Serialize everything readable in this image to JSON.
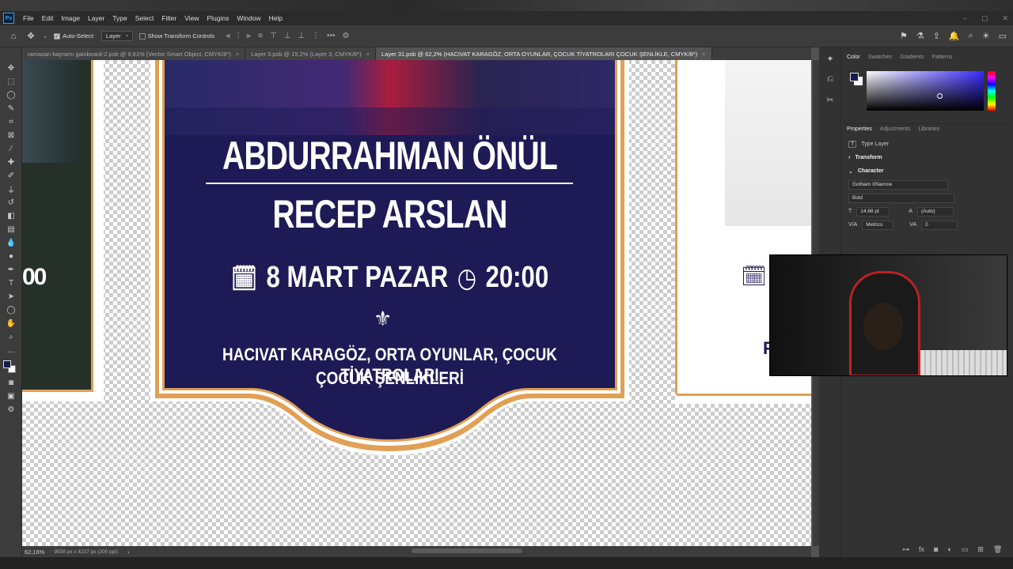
{
  "menubar": {
    "items": [
      "File",
      "Edit",
      "Image",
      "Layer",
      "Type",
      "Select",
      "Filter",
      "View",
      "Plugins",
      "Window",
      "Help"
    ]
  },
  "options": {
    "auto_select_label": "Auto-Select:",
    "auto_select_checked": true,
    "target_value": "Layer",
    "show_transform_label": "Show Transform Controls"
  },
  "tabs": [
    {
      "label": "ramazan bayramı gainboard-2.psb @ 9,61% (Vector Smart Object, CMYK/8*)",
      "active": false
    },
    {
      "label": "Layer 3.psb @ 15,2% (Layer 3, CMYK/8*)",
      "active": false
    },
    {
      "label": "Layer 31.psb @ 62,2% (HACIVAT KARAGÖZ, ORTA OYUNLAR, ÇOCUK TİYATROLARI ÇOCUK ŞENLİKLE, CMYK/8*)",
      "active": true
    }
  ],
  "poster": {
    "name1": "ABDURRAHMAN ÖNÜL",
    "name2": "RECEP ARSLAN",
    "date": "8  MART PAZAR",
    "time": "20:00",
    "line1": "HACIVAT KARAGÖZ, ORTA OYUNLAR, ÇOCUK TİYATROLARI",
    "line2": "ÇOCUK ŞENLİKLERİ",
    "left_time_fragment": "00",
    "right_fragment": "P",
    "colors": {
      "navy": "#1e1a55",
      "gold": "#e0a055",
      "white": "#ffffff"
    }
  },
  "color_panel": {
    "tabs": [
      "Color",
      "Swatches",
      "Gradients",
      "Patterns"
    ],
    "foreground": "#1b1a50",
    "background": "#ffffff"
  },
  "properties": {
    "tabs": [
      "Properties",
      "Adjustments",
      "Libraries"
    ],
    "layer_type": "Type Layer",
    "transform_label": "Transform",
    "character_label": "Character",
    "font_family": "Gotham XNarrow",
    "font_style": "Bold",
    "font_size": "14,68 pt",
    "leading": "(Auto)",
    "kerning": "Metrics",
    "tracking": "0"
  },
  "status": {
    "zoom": "62,16%",
    "doc_info": "9938 px x 4227 px (300 ppi)"
  }
}
